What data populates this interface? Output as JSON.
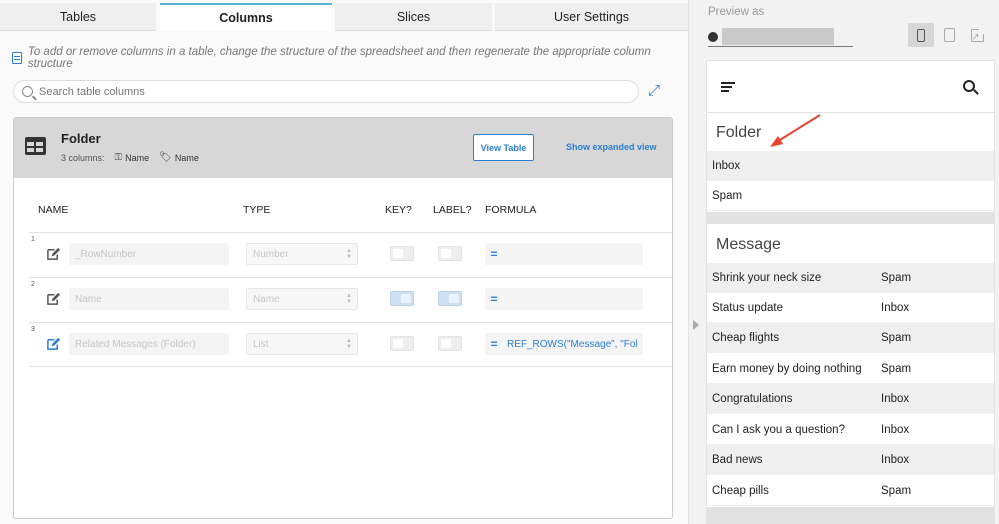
{
  "tabs": [
    "Tables",
    "Columns",
    "Slices",
    "User Settings"
  ],
  "hint_text": "To add or remove columns in a table, change the structure of the spreadsheet and then regenerate the appropriate column structure",
  "search": {
    "placeholder": "Search table columns"
  },
  "table_card": {
    "title": "Folder",
    "meta_count": "3 columns:",
    "meta_key": "Name",
    "meta_label": "Name",
    "view_table_label": "View Table",
    "show_expanded_label": "Show expanded view"
  },
  "columns_header": {
    "name": "NAME",
    "type": "TYPE",
    "key": "KEY?",
    "label": "LABEL?",
    "formula": "FORMULA"
  },
  "columns": [
    {
      "num": "1",
      "name": "_RowNumber",
      "type": "Number",
      "key": false,
      "label": false,
      "formula": "",
      "edit_active": false
    },
    {
      "num": "2",
      "name": "Name",
      "type": "Name",
      "key": true,
      "label": true,
      "formula": "",
      "edit_active": false
    },
    {
      "num": "3",
      "name": "Related Messages (Folder)",
      "type": "List",
      "key": false,
      "label": false,
      "formula": "REF_ROWS(\"Message\", \"Fol",
      "edit_active": true
    }
  ],
  "preview": {
    "label": "Preview as",
    "sections": [
      {
        "title": "Folder",
        "rows": [
          {
            "left": "Inbox",
            "right": ""
          },
          {
            "left": "Spam",
            "right": ""
          }
        ]
      },
      {
        "title": "Message",
        "rows": [
          {
            "left": "Shrink your neck size",
            "right": "Spam"
          },
          {
            "left": "Status update",
            "right": "Inbox"
          },
          {
            "left": "Cheap flights",
            "right": "Spam"
          },
          {
            "left": "Earn money by doing nothing",
            "right": "Spam"
          },
          {
            "left": "Congratulations",
            "right": "Inbox"
          },
          {
            "left": "Can I ask you a question?",
            "right": "Inbox"
          },
          {
            "left": "Bad news",
            "right": "Inbox"
          },
          {
            "left": "Cheap pills",
            "right": "Spam"
          }
        ]
      }
    ]
  },
  "colors": {
    "accent": "#2b7fd3",
    "tab_active_border": "#53b4d6",
    "annotation_arrow": "#e8432e"
  },
  "icons": [
    "book-icon",
    "search-icon",
    "expand-icon",
    "table-icon",
    "key-icon",
    "tag-icon",
    "edit-icon",
    "user-icon",
    "phone-icon",
    "tablet-icon",
    "external-link-icon",
    "menu-icon"
  ]
}
